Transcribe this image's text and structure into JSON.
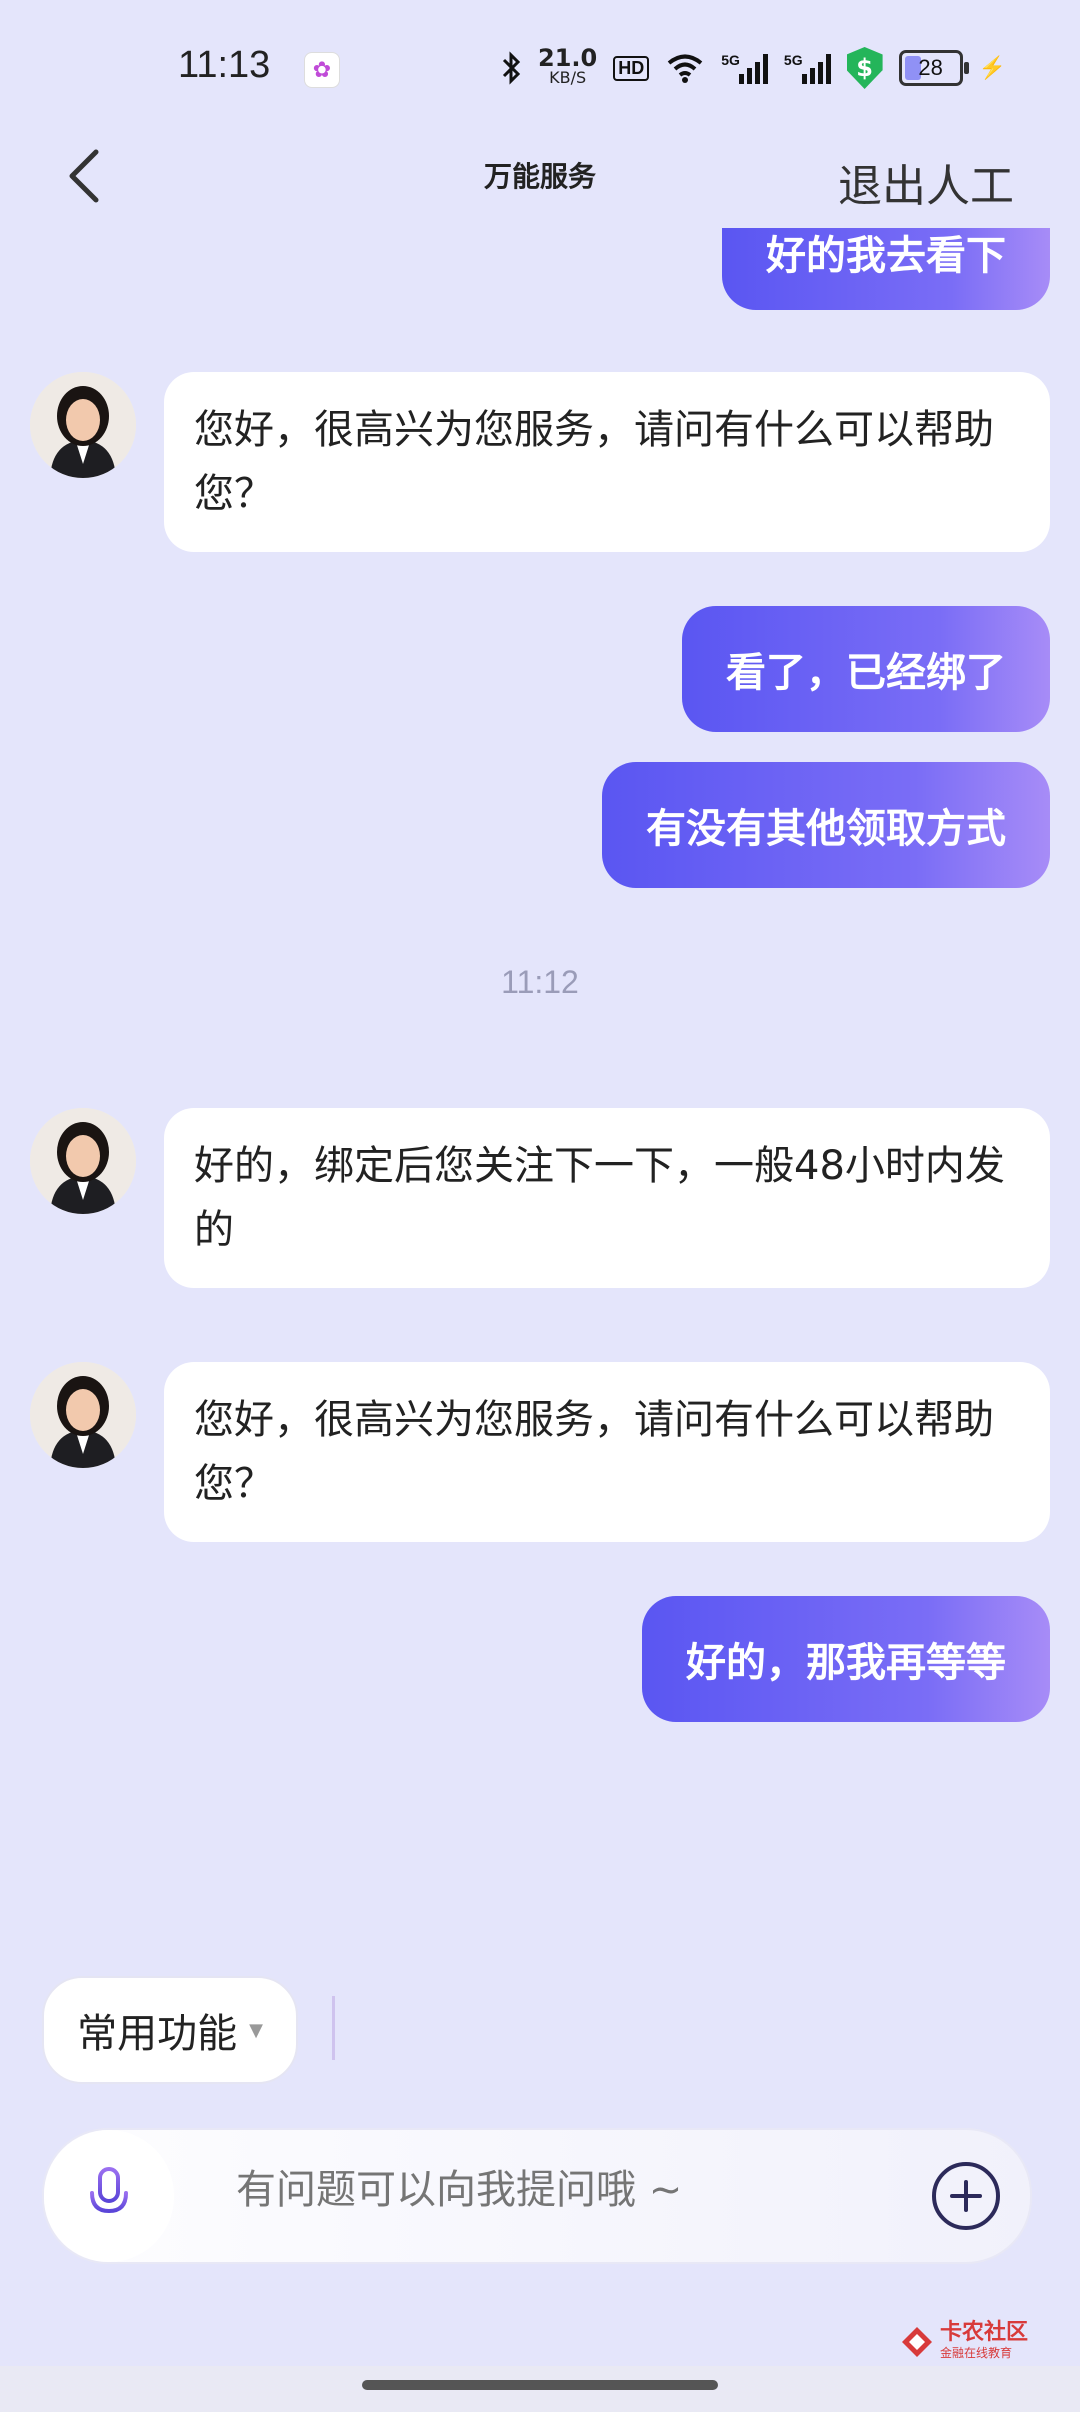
{
  "status_bar": {
    "time": "11:13",
    "net_speed": "21.0",
    "net_unit": "KB/S",
    "hd": "HD",
    "sim1": "5G",
    "sim2": "5G",
    "battery": "28"
  },
  "header": {
    "title": "万能服务",
    "exit_label": "退出人工"
  },
  "messages": [
    {
      "from": "user",
      "text": "好的我去看下"
    },
    {
      "from": "agent",
      "text": "您好，很高兴为您服务，请问有什么可以帮助您？"
    },
    {
      "from": "user",
      "text": "看了，已经绑了"
    },
    {
      "from": "user",
      "text": "有没有其他领取方式"
    },
    {
      "from": "time",
      "text": "11:12"
    },
    {
      "from": "agent",
      "text": "好的，绑定后您关注下一下，一般48小时内发的"
    },
    {
      "from": "agent",
      "text": "您好，很高兴为您服务，请问有什么可以帮助您？"
    },
    {
      "from": "user",
      "text": "好的，那我再等等"
    }
  ],
  "quick_menu": {
    "label": "常用功能"
  },
  "input": {
    "placeholder": "有问题可以向我提问哦 ~"
  },
  "watermark": {
    "line1": "卡农社区",
    "line2": "金融在线教育"
  },
  "colors": {
    "background": "#e4e5fb",
    "user_bubble_start": "#5a56f2",
    "user_bubble_end": "#a78cf7"
  }
}
